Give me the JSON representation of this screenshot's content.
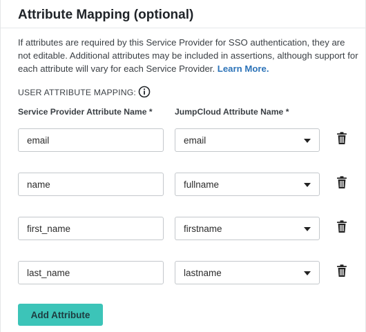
{
  "header": {
    "title": "Attribute Mapping (optional)"
  },
  "description": {
    "text": "If attributes are required by this Service Provider for SSO authentication, they are not editable. Additional attributes may be included in assertions, although support for each attribute will vary for each Service Provider. ",
    "link_label": "Learn More."
  },
  "section": {
    "label": "USER ATTRIBUTE MAPPING:",
    "info_icon": "info-icon"
  },
  "columns": {
    "service_provider": "Service Provider Attribute Name *",
    "jumpcloud": "JumpCloud Attribute Name *"
  },
  "rows": [
    {
      "sp_value": "email",
      "jc_value": "email"
    },
    {
      "sp_value": "name",
      "jc_value": "fullname"
    },
    {
      "sp_value": "first_name",
      "jc_value": "firstname"
    },
    {
      "sp_value": "last_name",
      "jc_value": "lastname"
    }
  ],
  "actions": {
    "add_label": "Add Attribute",
    "delete_icon": "trash-icon"
  },
  "colors": {
    "accent": "#3cc4b8",
    "link": "#2c73b8"
  }
}
